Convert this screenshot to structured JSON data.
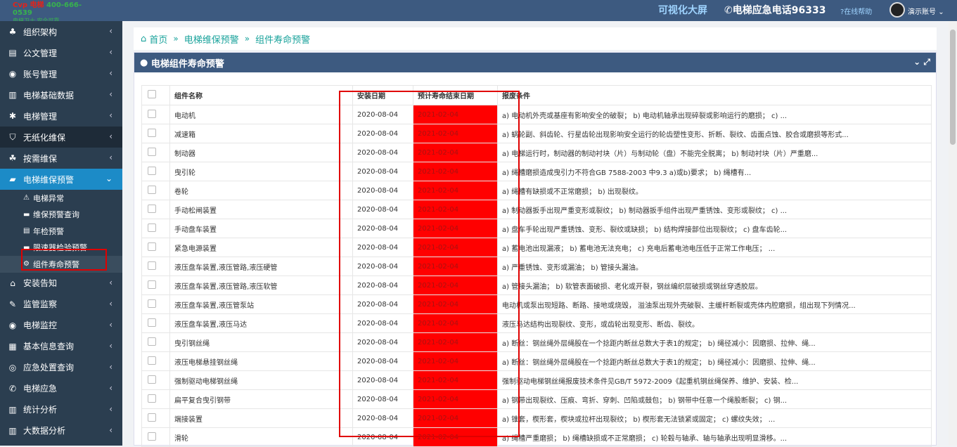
{
  "header": {
    "logo_line1": "Cvp 电梯",
    "logo_line2": "400-666-0539",
    "logo_line3": "电梯卫士 安全可靠",
    "visual_screen": "可视化大屏",
    "emergency_phone": "电梯应急电话96333",
    "online_help": "在线帮助",
    "account": "演示账号"
  },
  "sidebar": {
    "items": [
      {
        "label": "组织架构",
        "icon": "sitemap-icon"
      },
      {
        "label": "公文管理",
        "icon": "document-icon"
      },
      {
        "label": "账号管理",
        "icon": "user-circle-icon"
      },
      {
        "label": "电梯基础数据",
        "icon": "bar-chart-icon"
      },
      {
        "label": "电梯管理",
        "icon": "gear-icon"
      },
      {
        "label": "无纸化维保",
        "icon": "shield-icon"
      },
      {
        "label": "按需维保",
        "icon": "paw-icon"
      },
      {
        "label": "电梯维保预警",
        "icon": "briefcase-icon"
      },
      {
        "label": "安装告知",
        "icon": "bank-icon"
      },
      {
        "label": "监管监察",
        "icon": "gavel-icon"
      },
      {
        "label": "电梯监控",
        "icon": "record-icon"
      },
      {
        "label": "基本信息查询",
        "icon": "table-icon"
      },
      {
        "label": "应急处置查询",
        "icon": "lifebuoy-icon"
      },
      {
        "label": "电梯应急",
        "icon": "phone-volume-icon"
      },
      {
        "label": "统计分析",
        "icon": "bar-chart-icon"
      },
      {
        "label": "大数据分析",
        "icon": "bar-chart-icon"
      }
    ],
    "subitems": [
      {
        "label": "电梯异常"
      },
      {
        "label": "维保预警查询"
      },
      {
        "label": "年检预警"
      },
      {
        "label": "限速器检验预警"
      },
      {
        "label": "组件寿命预警"
      }
    ]
  },
  "breadcrumb": {
    "home": "首页",
    "level1": "电梯维保预警",
    "level2": "组件寿命预警"
  },
  "panel": {
    "title": "电梯组件寿命预警"
  },
  "table": {
    "headers": [
      "组件名称",
      "安装日期",
      "预计寿命结束日期",
      "报废条件"
    ],
    "rows": [
      [
        "电动机",
        "2020-08-04",
        "2021-02-04",
        "a) 电动机外壳或基座有影响安全的破裂； b) 电动机轴承出现碎裂或影响运行的磨损； c) ..."
      ],
      [
        "减速箱",
        "2020-08-04",
        "2021-02-04",
        "a) 蜗轮副、斜齿轮、行星齿轮出现影响安全运行的轮齿塑性变形、折断、裂纹、齿面点蚀、胶合或磨损等形式..."
      ],
      [
        "制动器",
        "2020-08-04",
        "2021-02-04",
        "a) 电梯运行时，制动器的制动衬块（片）与制动轮（盘）不能完全脱离； b) 制动衬块（片）严重磨..."
      ],
      [
        "曳引轮",
        "2020-08-04",
        "2021-02-04",
        "a) 绳槽磨损造成曳引力不符合GB 7588-2003 中9.3 a)或b)要求； b) 绳槽有..."
      ],
      [
        "卷轮",
        "2020-08-04",
        "2021-02-04",
        "a) 绳槽有缺损或不正常磨损； b) 出现裂纹。"
      ],
      [
        "手动松闸装置",
        "2020-08-04",
        "2021-02-04",
        "a) 制动器扳手出现严重变形或裂纹； b) 制动器扳手组件出现严重锈蚀、变形或裂纹； c) ..."
      ],
      [
        "手动盘车装置",
        "2020-08-04",
        "2021-02-04",
        "a) 盘车手轮出现严重锈蚀、变形、裂纹或缺损； b) 结构焊接部位出现裂纹； c) 盘车齿轮..."
      ],
      [
        "紧急电源装置",
        "2020-08-04",
        "2021-02-04",
        "a) 蓄电池出现漏液； b) 蓄电池无法充电； c) 充电后蓄电池电压低于正常工作电压； ..."
      ],
      [
        "液压盘车装置,液压管路,液压硬管",
        "2020-08-04",
        "2021-02-04",
        "a) 严重锈蚀、变形或漏油； b) 管接头漏油。"
      ],
      [
        "液压盘车装置,液压管路,液压软管",
        "2020-08-04",
        "2021-02-04",
        "a) 管接头漏油； b) 软管表面破损、老化或开裂，钢丝编织层破损或钢丝穿透胶层。"
      ],
      [
        "液压盘车装置,液压管泵站",
        "2020-08-04",
        "2021-02-04",
        "电动机或泵出现短路、断路、接地或烧毁， 溢油泵出现外壳破裂、主缓杆断裂或壳体内腔磨损，组出现下列情况..."
      ],
      [
        "液压盘车装置,液压马达",
        "2020-08-04",
        "2021-02-04",
        "液压马达结构出现裂纹、变形，或齿轮出现变形、断齿、裂纹。"
      ],
      [
        "曳引钢丝绳",
        "2020-08-04",
        "2021-02-04",
        "a) 断丝：钢丝绳外层绳股在一个捻距内断丝总数大于表1的规定； b) 绳径减小：因磨损、拉伸、绳..."
      ],
      [
        "液压电梯悬挂钢丝绳",
        "2020-08-04",
        "2021-02-04",
        "a) 断丝：钢丝绳外层绳股在一个捻距内断丝总数大于表1的规定； b) 绳径减小：因磨损、拉伸、绳..."
      ],
      [
        "强制驱动电梯钢丝绳",
        "2020-08-04",
        "2021-02-04",
        "强制驱动电梯钢丝绳报废技术条件见GB/T 5972-2009《起重机钢丝绳保养、维护、安装、检..."
      ],
      [
        "扁平复合曳引钢带",
        "2020-08-04",
        "2021-02-04",
        "a) 钢带出现裂纹、压痕、弯折、穿刺、凹陷或鼓包； b) 钢带中任意一个绳股断裂； c) 钢..."
      ],
      [
        "端接装置",
        "2020-08-04",
        "2021-02-04",
        "a) 锥套，楔形套，楔块或拉杆出现裂纹； b) 楔形套无法锁紧或固定； c) 螺纹失效； ..."
      ],
      [
        "滑轮",
        "2020-08-04",
        "2021-02-04",
        "a) 绳槽严重磨损； b) 绳槽缺损或不正常磨损； c) 轮毂与轴承、轴与轴承出现明显滑移。..."
      ]
    ]
  }
}
